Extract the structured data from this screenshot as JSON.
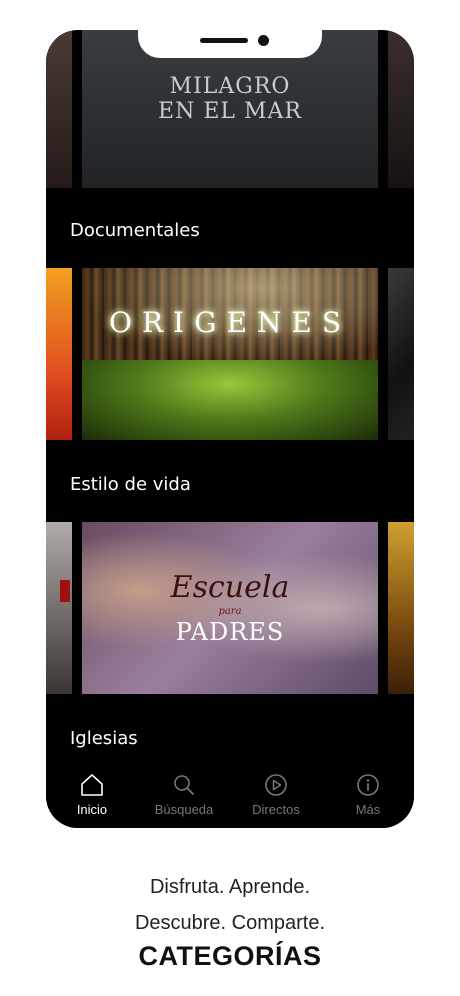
{
  "feed": {
    "rows": [
      {
        "poster_title_line1": "MILAGRO",
        "poster_title_line2": "EN EL MAR"
      },
      {
        "section_label": "Documentales",
        "poster_title": "ORIGENES"
      },
      {
        "section_label": "Estilo de vida",
        "poster_title_line1": "Escuela",
        "poster_title_small": "para",
        "poster_title_line2": "PADRES"
      },
      {
        "section_label": "Iglesias"
      }
    ]
  },
  "tabbar": {
    "tabs": [
      {
        "label": "Inicio",
        "icon": "home-icon",
        "active": true
      },
      {
        "label": "Búsqueda",
        "icon": "search-icon",
        "active": false
      },
      {
        "label": "Directos",
        "icon": "play-icon",
        "active": false
      },
      {
        "label": "Más",
        "icon": "info-icon",
        "active": false
      }
    ]
  },
  "caption": {
    "line1": "Disfruta. Aprende.",
    "line2": "Descubre. Comparte.",
    "headline": "CATEGORÍAS"
  },
  "colors": {
    "background": "#ffffff",
    "phone": "#000000",
    "tab_active": "#ffffff",
    "tab_inactive": "#777777"
  }
}
